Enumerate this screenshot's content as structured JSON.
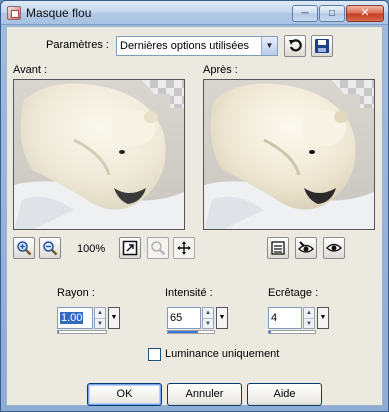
{
  "window": {
    "title": "Masque flou"
  },
  "caption_buttons": {
    "minimize": "─",
    "maximize": "□",
    "close": "✕"
  },
  "params": {
    "label": "Paramètres :",
    "value": "Dernières options utilisées"
  },
  "preview": {
    "before_label": "Avant :",
    "after_label": "Après :",
    "zoom": "100%"
  },
  "icons": {
    "dropdown_arrow": "▼",
    "reset": "reset-icon",
    "save": "save-icon",
    "zoom_in": "zoom-in-icon",
    "zoom_out": "zoom-out-icon",
    "fit": "fit-window-icon",
    "zoom_proof": "zoom-disabled-icon",
    "pan": "move-icon",
    "proof": "proof-icon",
    "auto_proof": "auto-proof-icon",
    "show_preview": "eye-icon",
    "spin_up": "▲",
    "spin_down": "▼"
  },
  "fields": {
    "rayon": {
      "label": "Rayon :",
      "value": "1.00",
      "level": 0.01
    },
    "intensite": {
      "label": "Intensité :",
      "value": "65",
      "level": 0.65
    },
    "ecretage": {
      "label": "Ecrêtage :",
      "value": "4",
      "level": 0.04
    }
  },
  "luminance": {
    "label": "Luminance uniquement",
    "checked": false
  },
  "buttons": {
    "ok": "OK",
    "cancel": "Annuler",
    "help": "Aide"
  },
  "colors": {
    "titlebar": "#b7cde9",
    "client": "#ece9e0",
    "accent": "#316ac5"
  }
}
